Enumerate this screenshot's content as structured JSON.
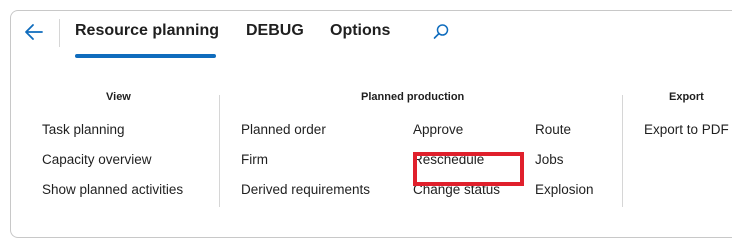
{
  "tabs": [
    {
      "label": "Resource planning",
      "active": true
    },
    {
      "label": "DEBUG",
      "active": false
    },
    {
      "label": "Options",
      "active": false
    }
  ],
  "icons": {
    "back": "arrow-left-icon",
    "search": "search-icon"
  },
  "colors": {
    "accent": "#0f6cbd",
    "highlight_box": "#e0202c"
  },
  "groups": {
    "view": {
      "title": "View",
      "items": [
        "Task planning",
        "Capacity overview",
        "Show planned activities"
      ]
    },
    "planned_production": {
      "title": "Planned production",
      "col1": [
        "Planned order",
        "Firm",
        "Derived requirements"
      ],
      "col2": [
        "Approve",
        "Reschedule",
        "Change status"
      ],
      "col3": [
        "Route",
        "Jobs",
        "Explosion"
      ]
    },
    "export": {
      "title": "Export",
      "items": [
        "Export to PDF"
      ]
    }
  },
  "highlighted_command": "Reschedule"
}
